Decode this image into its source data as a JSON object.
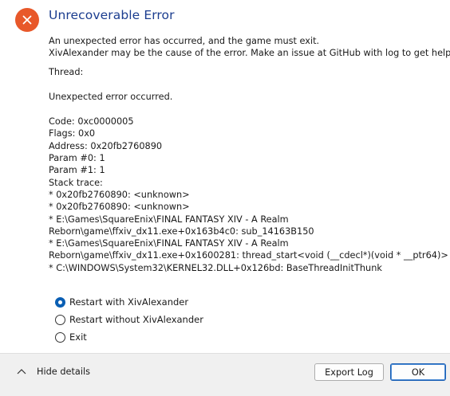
{
  "dialog": {
    "title": "Unrecoverable Error",
    "icon": "error-x-icon",
    "accent_color": "#e8582a",
    "title_color": "#1b3d8f"
  },
  "message": {
    "line1": "An unexpected error has occurred, and the game must exit.",
    "line2": "XivAlexander may be the cause of the error. Make an issue at GitHub with log to get help.",
    "thread": "Thread:",
    "unexpected": "Unexpected error occurred.",
    "details": [
      "Code: 0xc0000005",
      "Flags: 0x0",
      "Address: 0x20fb2760890",
      "Param #0: 1",
      "Param #1: 1",
      "Stack trace:",
      "* 0x20fb2760890: <unknown>",
      "* 0x20fb2760890: <unknown>",
      "* E:\\Games\\SquareEnix\\FINAL FANTASY XIV - A Realm",
      "Reborn\\game\\ffxiv_dx11.exe+0x163b4c0: sub_14163B150",
      "* E:\\Games\\SquareEnix\\FINAL FANTASY XIV - A Realm",
      "Reborn\\game\\ffxiv_dx11.exe+0x1600281: thread_start<void (__cdecl*)(void * __ptr64)>",
      "* C:\\WINDOWS\\System32\\KERNEL32.DLL+0x126bd: BaseThreadInitThunk"
    ]
  },
  "options": {
    "selected_index": 0,
    "items": [
      {
        "label": "Restart with XivAlexander",
        "checked": true
      },
      {
        "label": "Restart without XivAlexander",
        "checked": false
      },
      {
        "label": "Exit",
        "checked": false
      }
    ]
  },
  "footer": {
    "hide_details_label": "Hide details",
    "hide_details_icon": "chevron-up-icon",
    "export_log_label": "Export Log",
    "ok_label": "OK"
  }
}
